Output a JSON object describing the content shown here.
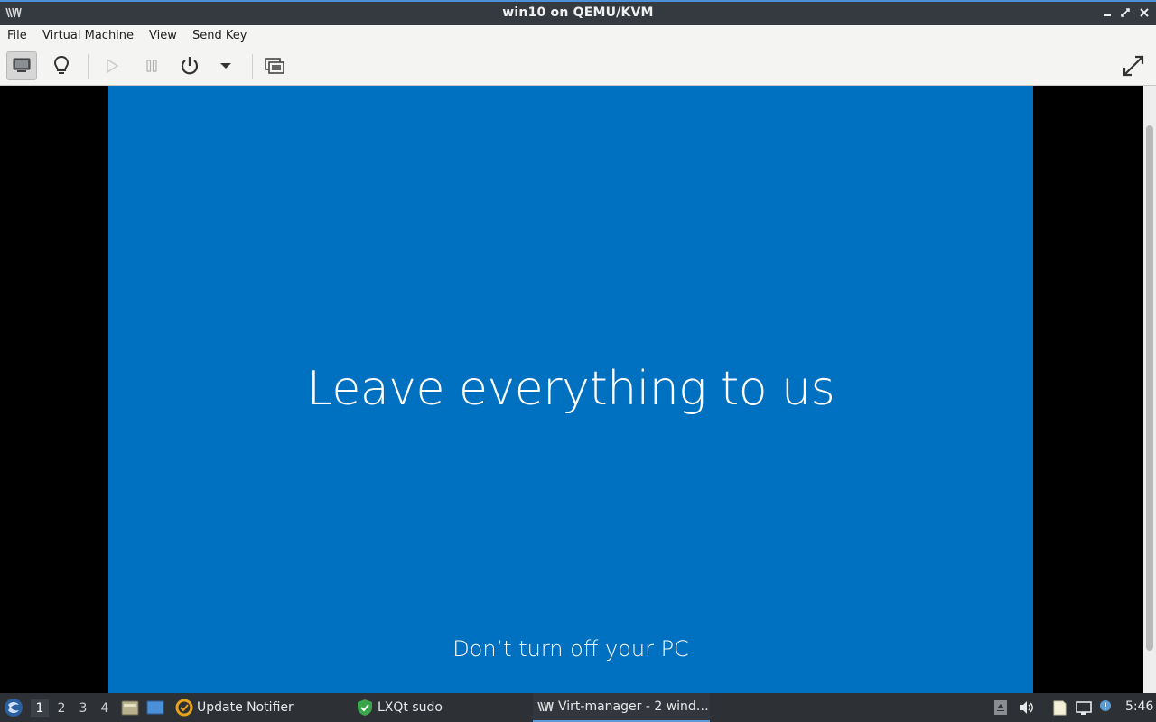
{
  "window": {
    "title": "win10 on QEMU/KVM"
  },
  "menubar": {
    "items": [
      "File",
      "Virtual Machine",
      "View",
      "Send Key"
    ]
  },
  "toolbar": {
    "buttons": [
      "monitor-icon",
      "lightbulb-icon",
      "play-icon",
      "pause-icon",
      "power-icon",
      "chevron-down-icon",
      "snapshots-icon",
      "fullscreen-icon"
    ]
  },
  "vm_screen": {
    "headline": "Leave everything to us",
    "subline": "Don’t turn off your PC",
    "background_color": "#0070c1"
  },
  "taskbar": {
    "desktops": [
      "1",
      "2",
      "3",
      "4"
    ],
    "active_desktop": "1",
    "tasks": [
      {
        "label": "Update Notifier",
        "icon": "update-notifier-icon"
      },
      {
        "label": "LXQt sudo",
        "icon": "shield-check-icon"
      },
      {
        "label": "Virt-manager - 2 wind…",
        "icon": "virt-manager-icon",
        "active": true
      }
    ],
    "clock": "5:46"
  }
}
